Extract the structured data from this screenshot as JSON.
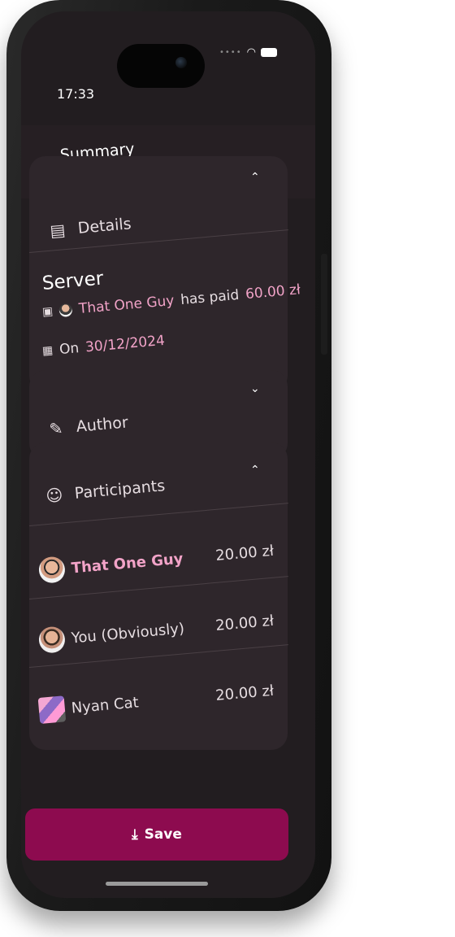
{
  "status_bar": {
    "time": "17:33"
  },
  "header": {
    "back_icon": "chevron-left-icon",
    "title": "Summary"
  },
  "details": {
    "heading": "Details",
    "icon": "receipt-icon",
    "collapse_icon": "chevron-up-icon",
    "expense_name": "Server",
    "payer_name": "That One Guy",
    "paid_text": "has paid",
    "amount": "60.00 zł",
    "date_prefix": "On",
    "date": "30/12/2024"
  },
  "author": {
    "heading": "Author",
    "icon": "pen-icon",
    "expand_icon": "chevron-down-icon"
  },
  "participants": {
    "heading": "Participants",
    "icon": "users-icon",
    "collapse_icon": "chevron-up-icon",
    "items": [
      {
        "name": "That One Guy",
        "amount": "20.00 zł"
      },
      {
        "name": "You (Obviously)",
        "amount": "20.00 zł"
      },
      {
        "name": "Nyan Cat",
        "amount": "20.00 zł"
      }
    ]
  },
  "save_button": {
    "label": "Save",
    "icon": "download-icon"
  },
  "colors": {
    "accent": "#8d0b4f",
    "highlight": "#f2a3c8",
    "background": "#221d20",
    "card": "#2e262b"
  }
}
